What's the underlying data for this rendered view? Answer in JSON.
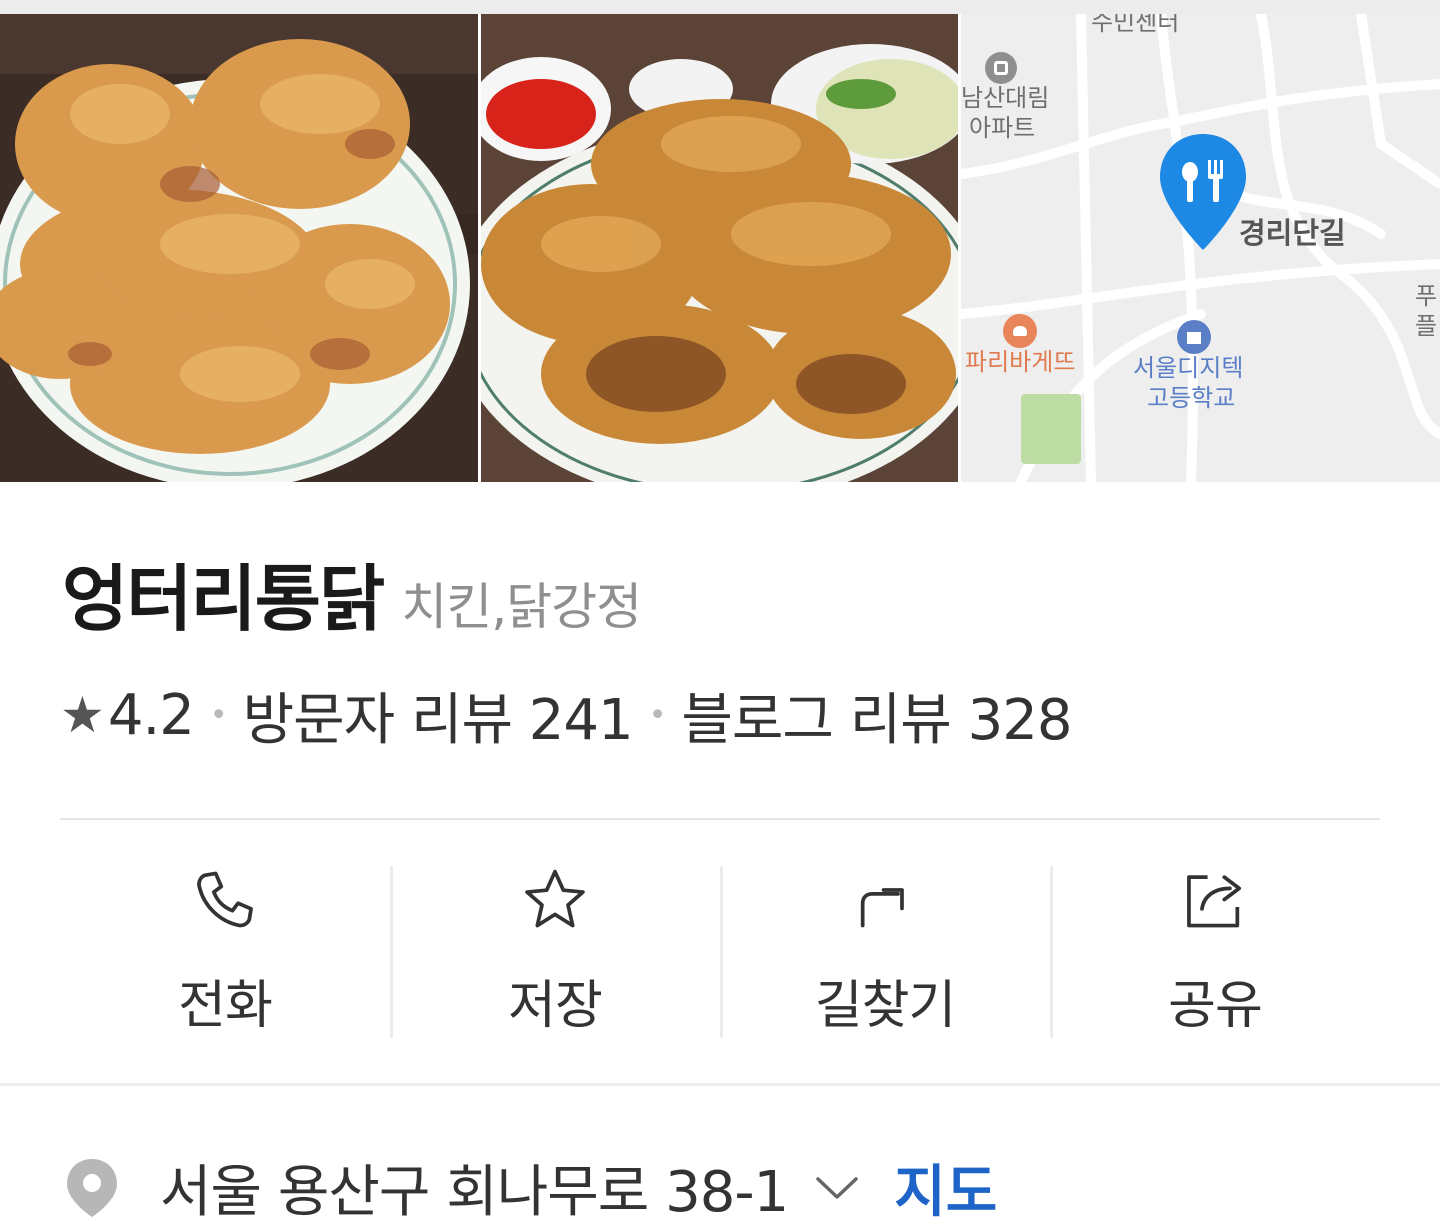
{
  "gallery": {
    "photos": [
      {
        "alt": "fried-chicken-photo"
      },
      {
        "alt": "fried-chicken-with-sauce-photo"
      }
    ],
    "map": {
      "labels": {
        "top": "수민센터",
        "apartment_1": "남산대림",
        "apartment_2": "아파트",
        "pin_road": "경리단길",
        "bakery": "파리바게뜨",
        "school_1": "서울디지텍",
        "school_2": "고등학교",
        "edge_1": "푸",
        "edge_2": "플"
      },
      "pin_color": "#1e88e5"
    }
  },
  "place": {
    "name": "엉터리통닭",
    "category": "치킨,닭강정"
  },
  "meta": {
    "rating": "4.2",
    "visitor_reviews": "방문자 리뷰 241",
    "blog_reviews": "블로그 리뷰 328"
  },
  "actions": [
    {
      "label": "전화",
      "icon": "phone-icon"
    },
    {
      "label": "저장",
      "icon": "star-outline-icon"
    },
    {
      "label": "길찾기",
      "icon": "directions-icon"
    },
    {
      "label": "공유",
      "icon": "share-icon"
    }
  ],
  "address": {
    "text": "서울 용산구 회나무로 38-1",
    "map_link": "지도",
    "link_color": "#1e64c8"
  }
}
